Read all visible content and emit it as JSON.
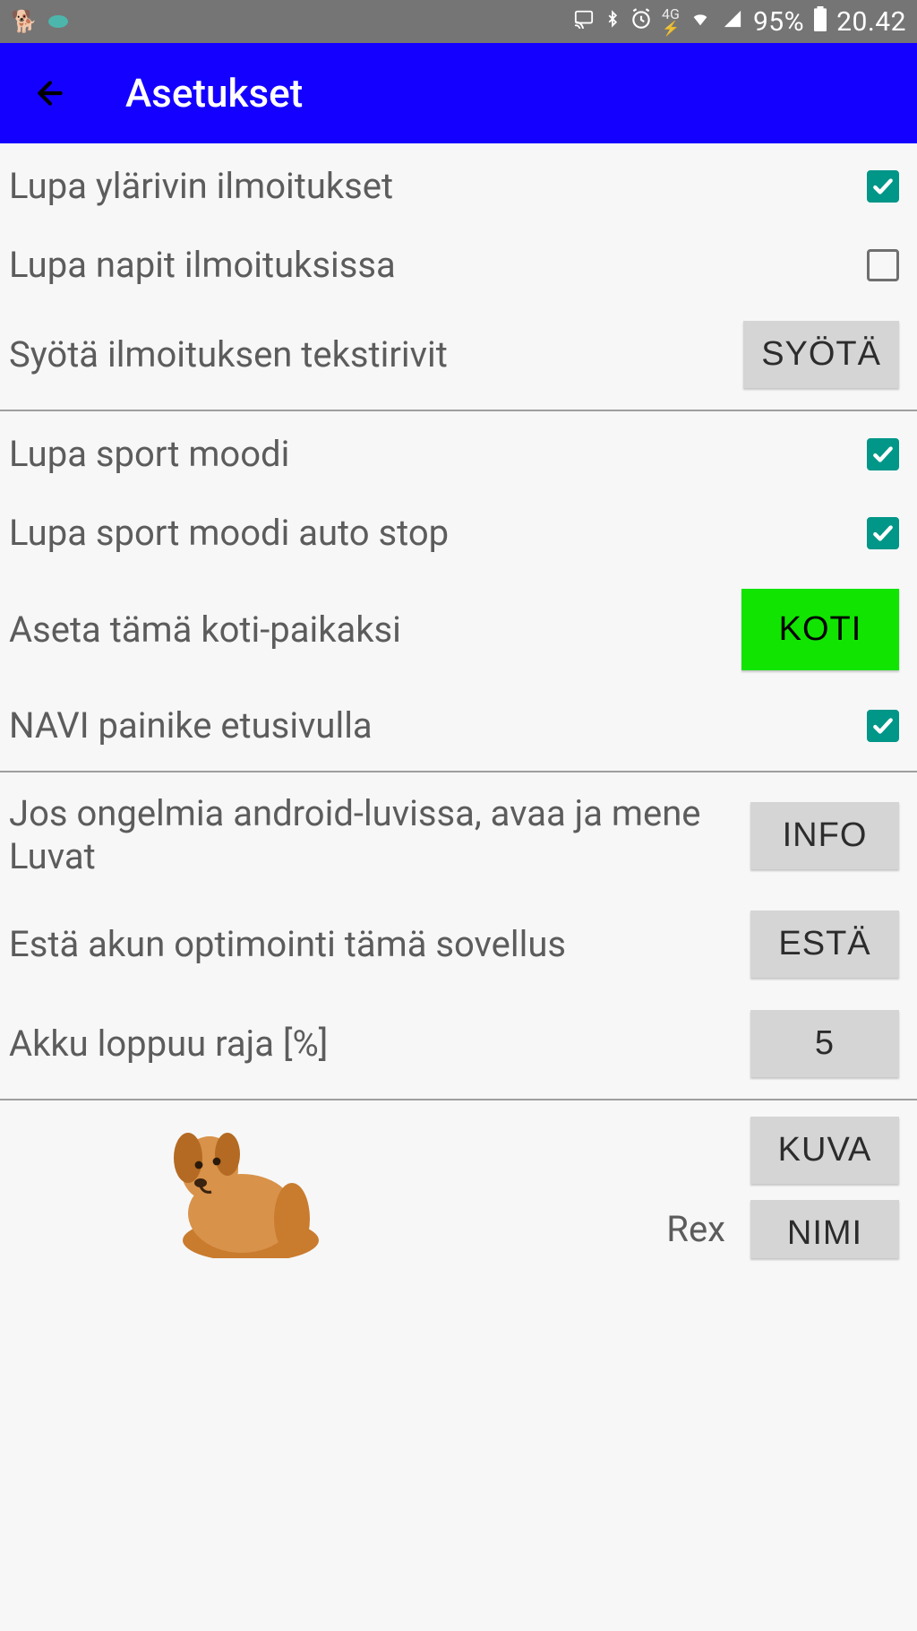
{
  "status": {
    "battery_pct": "95%",
    "time": "20.42",
    "network_label": "4G"
  },
  "appbar": {
    "title": "Asetukset"
  },
  "section1": {
    "notif_top": {
      "label": "Lupa ylärivin ilmoitukset",
      "checked": true
    },
    "notif_buttons": {
      "label": "Lupa napit ilmoituksissa",
      "checked": false
    },
    "notif_text": {
      "label": "Syötä ilmoituksen tekstirivit",
      "button": "SYÖTÄ"
    }
  },
  "section2": {
    "sport_mode": {
      "label": "Lupa sport moodi",
      "checked": true
    },
    "sport_autostop": {
      "label": "Lupa sport moodi auto stop",
      "checked": true
    },
    "set_home": {
      "label": "Aseta tämä koti-paikaksi",
      "button": "KOTI"
    },
    "navi_home": {
      "label": "NAVI painike etusivulla",
      "checked": true
    }
  },
  "section3": {
    "perms": {
      "label": "Jos ongelmia android-luvissa, avaa ja mene Luvat",
      "button": "INFO"
    },
    "batt_opt": {
      "label": "Estä akun optimointi tämä sovellus",
      "button": "ESTÄ"
    },
    "batt_limit": {
      "label": "Akku loppuu raja [%]",
      "button": "5"
    }
  },
  "dog": {
    "name": "Rex",
    "image_button": "KUVA",
    "name_button": "NIMI"
  }
}
